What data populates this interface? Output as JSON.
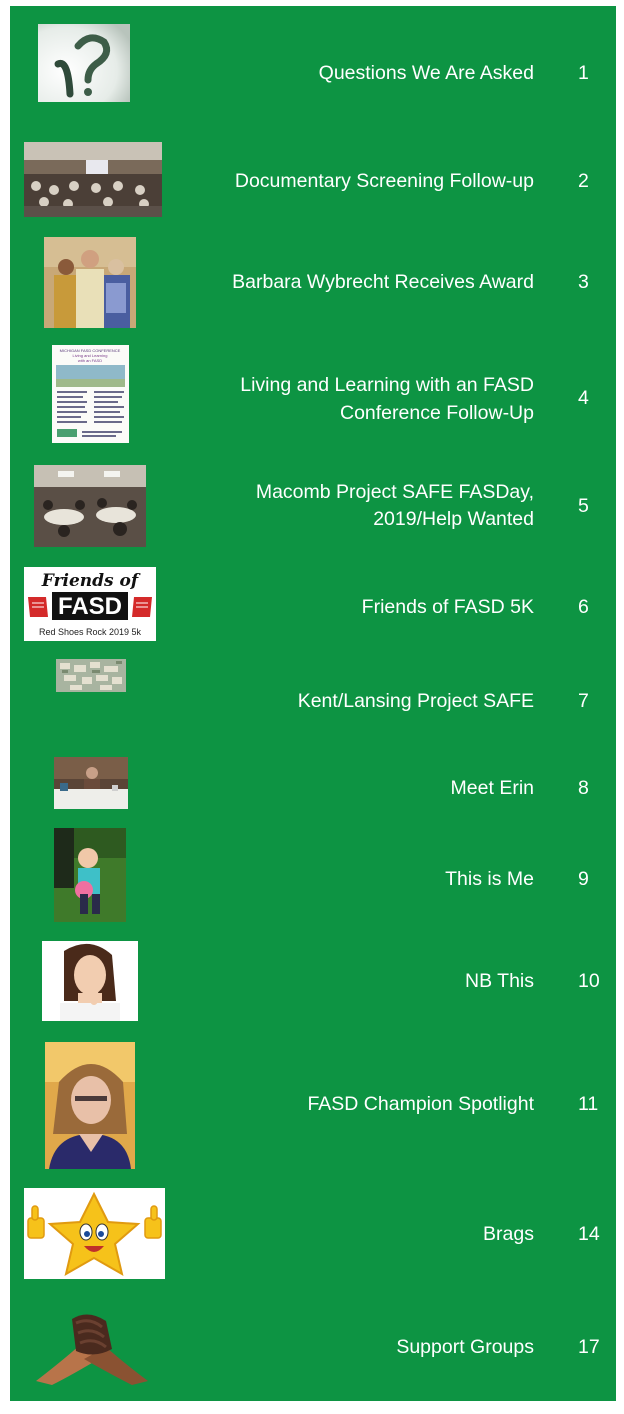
{
  "toc": {
    "entries": [
      {
        "title": "Questions We Are Asked",
        "page": "1",
        "image": "question-mark-icon"
      },
      {
        "title": "Documentary Screening Follow-up",
        "page": "2",
        "image": "screening-room-photo"
      },
      {
        "title": "Barbara Wybrecht Receives Award",
        "page": "3",
        "image": "award-photo"
      },
      {
        "title_line1": "Living and Learning with an FASD",
        "title_line2": "Conference Follow-Up",
        "page": "4",
        "image": "conference-flyer"
      },
      {
        "title_line1": "Macomb Project SAFE FASDay,",
        "title_line2": "2019/Help Wanted",
        "page": "5",
        "image": "meeting-photo"
      },
      {
        "title": "Friends of FASD 5K",
        "page": "6",
        "image": "friends-of-fasd-logo"
      },
      {
        "title": "Kent/Lansing Project SAFE",
        "page": "7",
        "image": "project-safe-table-photo"
      },
      {
        "title": "Meet Erin",
        "page": "8",
        "image": "erin-photo"
      },
      {
        "title": "This is Me",
        "page": "9",
        "image": "child-photo"
      },
      {
        "title": "NB This",
        "page": "10",
        "image": "thinking-woman-photo"
      },
      {
        "title": "FASD Champion Spotlight",
        "page": "11",
        "image": "champion-portrait"
      },
      {
        "title": "Brags",
        "page": "14",
        "image": "star-thumbs-up-icon"
      },
      {
        "title": "Support Groups",
        "page": "17",
        "image": "clasped-hands-icon"
      }
    ]
  },
  "logo": {
    "line1": "Friends of",
    "line2": "FASD",
    "line3": "Red Shoes Rock 2019 5k"
  },
  "flyer": {
    "heading1": "MICHIGAN FASD CONFERENCE",
    "heading2": "Living and Learning",
    "heading3": "with an FASD"
  },
  "colors": {
    "background": "#0d9443",
    "text": "#ffffff"
  }
}
